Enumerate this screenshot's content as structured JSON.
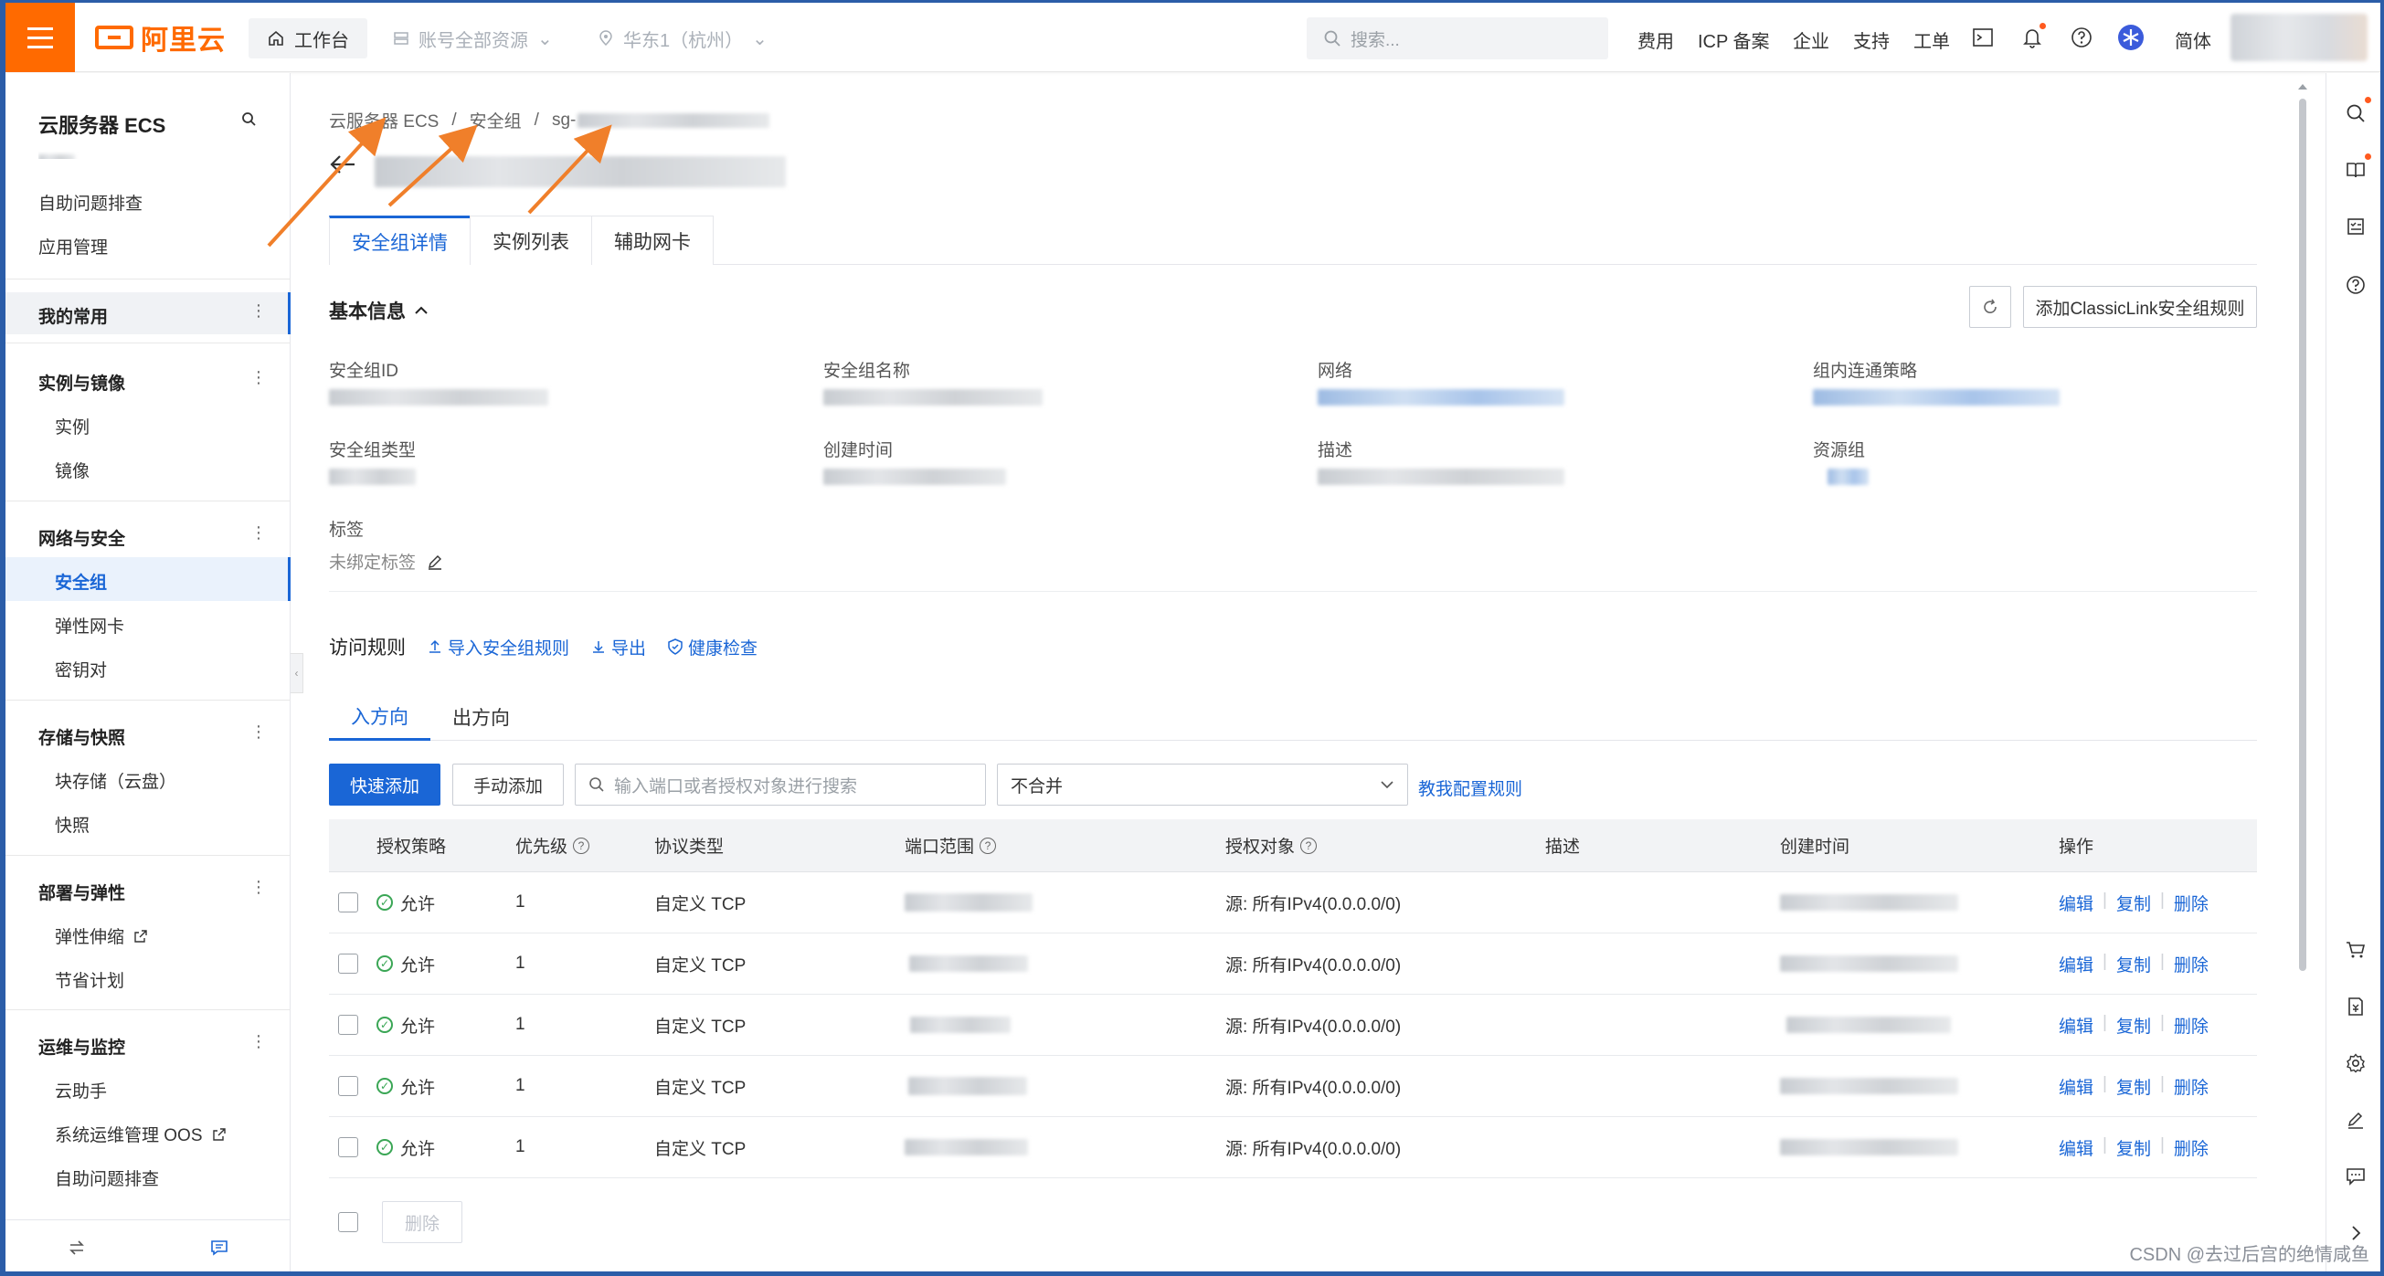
{
  "topbar": {
    "logo_text": "阿里云",
    "workbench": "工作台",
    "resources": "账号全部资源",
    "region": "华东1（杭州）",
    "search_placeholder": "搜索...",
    "links": [
      "费用",
      "ICP 备案",
      "企业",
      "支持",
      "工单"
    ],
    "lang": "简体"
  },
  "sidebar": {
    "title": "云服务器 ECS",
    "top_items": [
      "自助问题排查",
      "应用管理"
    ],
    "favorites": "我的常用",
    "groups": [
      {
        "name": "实例与镜像",
        "items": [
          "实例",
          "镜像"
        ]
      },
      {
        "name": "网络与安全",
        "items": [
          "安全组",
          "弹性网卡",
          "密钥对"
        ]
      },
      {
        "name": "存储与快照",
        "items": [
          "块存储（云盘）",
          "快照"
        ]
      },
      {
        "name": "部署与弹性",
        "items": [
          "弹性伸缩",
          "节省计划"
        ]
      },
      {
        "name": "运维与监控",
        "items": [
          "云助手",
          "系统运维管理 OOS",
          "自助问题排查"
        ]
      }
    ],
    "active": "安全组"
  },
  "breadcrumb": [
    "云服务器 ECS",
    "安全组",
    "sg-"
  ],
  "tabs": [
    "安全组详情",
    "实例列表",
    "辅助网卡"
  ],
  "basic_info": {
    "title": "基本信息",
    "add_button": "添加ClassicLink安全组规则",
    "fields": [
      {
        "label": "安全组ID"
      },
      {
        "label": "安全组名称"
      },
      {
        "label": "网络"
      },
      {
        "label": "组内连通策略"
      },
      {
        "label": "安全组类型"
      },
      {
        "label": "创建时间"
      },
      {
        "label": "描述"
      },
      {
        "label": "资源组"
      }
    ],
    "tag_label": "标签",
    "tag_value": "未绑定标签"
  },
  "rules": {
    "title": "访问规则",
    "import": "导入安全组规则",
    "export": "导出",
    "health": "健康检查",
    "dir_tabs": [
      "入方向",
      "出方向"
    ],
    "quick_add": "快速添加",
    "manual_add": "手动添加",
    "search_placeholder": "输入端口或者授权对象进行搜索",
    "merge_select": "不合并",
    "teach_link": "教我配置规则",
    "columns": [
      "授权策略",
      "优先级",
      "协议类型",
      "端口范围",
      "授权对象",
      "描述",
      "创建时间",
      "操作"
    ],
    "rows": [
      {
        "policy": "允许",
        "priority": "1",
        "protocol": "自定义 TCP",
        "target": "源: 所有IPv4(0.0.0.0/0)"
      },
      {
        "policy": "允许",
        "priority": "1",
        "protocol": "自定义 TCP",
        "target": "源: 所有IPv4(0.0.0.0/0)"
      },
      {
        "policy": "允许",
        "priority": "1",
        "protocol": "自定义 TCP",
        "target": "源: 所有IPv4(0.0.0.0/0)"
      },
      {
        "policy": "允许",
        "priority": "1",
        "protocol": "自定义 TCP",
        "target": "源: 所有IPv4(0.0.0.0/0)"
      },
      {
        "policy": "允许",
        "priority": "1",
        "protocol": "自定义 TCP",
        "target": "源: 所有IPv4(0.0.0.0/0)"
      }
    ],
    "ops": [
      "编辑",
      "复制",
      "删除"
    ],
    "delete_button": "删除"
  },
  "watermark": "CSDN @去过后宫的绝情咸鱼",
  "colors": {
    "brand": "#ff6a00",
    "primary": "#1a66d6",
    "allow": "#3aa655",
    "annotation_arrow": "#f07f2a"
  }
}
